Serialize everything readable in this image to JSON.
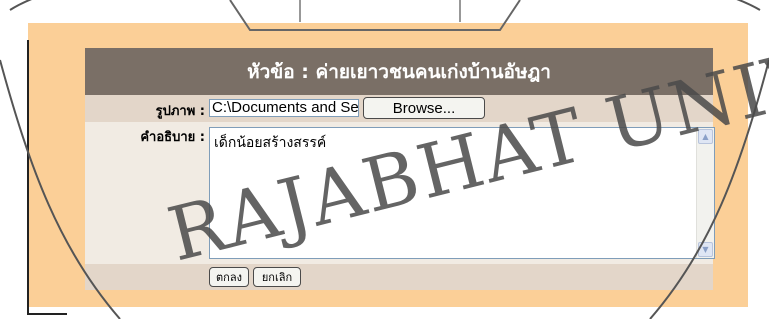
{
  "form": {
    "title": "หัวข้อ : ค่ายเยาวชนคนเก่งบ้านอัษฎา",
    "image_label": "รูปภาพ :",
    "image_path": "C:\\Documents and Setti",
    "browse_label": "Browse...",
    "description_label": "คำอธิบาย :",
    "description_value": "เด็กน้อยสร้างสรรค์",
    "ok_label": "ตกลง",
    "cancel_label": "ยกเลิก"
  },
  "watermark": {
    "text": "RAJABHAT UNIV"
  },
  "colors": {
    "panel": "#fbcf97",
    "header": "#7a6f66",
    "row": "#e3d6c9",
    "row_light": "#f1ebe3"
  }
}
